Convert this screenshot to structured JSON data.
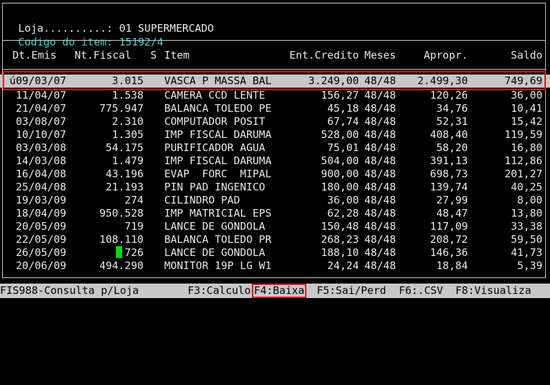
{
  "header": {
    "store_label": "Loja..........:",
    "store_value": "01 SUPERMERCADO",
    "item_label": "Codigo do item:",
    "item_value": "15192/4"
  },
  "columns": {
    "dt_emis": "Dt.Emis",
    "nt_fiscal": "Nt.Fiscal",
    "s": "S",
    "item": "Item",
    "ent_credito": "Ent.Credito",
    "meses": "Meses",
    "apropr": "Apropr.",
    "saldo": "Saldo"
  },
  "rows": [
    {
      "dt": "ú09/03/07",
      "nf": "3.015",
      "item": "VASCA P MASSA BAL",
      "ent": "3.249,00",
      "meses": "48/48",
      "apr": "2.499,30",
      "saldo": "749,69"
    },
    {
      "dt": "11/04/07",
      "nf": "1.538",
      "item": "CAMERA CCD LENTE",
      "ent": "156,27",
      "meses": "48/48",
      "apr": "120,26",
      "saldo": "36,00"
    },
    {
      "dt": "21/04/07",
      "nf": "775.947",
      "item": "BALANCA TOLEDO PE",
      "ent": "45,18",
      "meses": "48/48",
      "apr": "34,76",
      "saldo": "10,41"
    },
    {
      "dt": "03/08/07",
      "nf": "2.310",
      "item": "COMPUTADOR POSIT",
      "ent": "67,74",
      "meses": "48/48",
      "apr": "52,31",
      "saldo": "15,42"
    },
    {
      "dt": "10/10/07",
      "nf": "1.305",
      "item": "IMP FISCAL DARUMA",
      "ent": "528,00",
      "meses": "48/48",
      "apr": "408,40",
      "saldo": "119,59"
    },
    {
      "dt": "03/03/08",
      "nf": "54.175",
      "item": "PURIFICADOR AGUA",
      "ent": "75,01",
      "meses": "48/48",
      "apr": "58,20",
      "saldo": "16,80"
    },
    {
      "dt": "14/03/08",
      "nf": "1.479",
      "item": "IMP FISCAL DARUMA",
      "ent": "504,00",
      "meses": "48/48",
      "apr": "391,13",
      "saldo": "112,86"
    },
    {
      "dt": "16/04/08",
      "nf": "43.196",
      "item": "EVAP  FORC  MIPAL",
      "ent": "900,00",
      "meses": "48/48",
      "apr": "698,73",
      "saldo": "201,27"
    },
    {
      "dt": "25/04/08",
      "nf": "21.193",
      "item": "PIN PAD INGENICO",
      "ent": "180,00",
      "meses": "48/48",
      "apr": "139,74",
      "saldo": "40,25"
    },
    {
      "dt": "19/03/09",
      "nf": "274",
      "item": "CILINDRO PAD",
      "ent": "36,00",
      "meses": "48/48",
      "apr": "27,99",
      "saldo": "8,00"
    },
    {
      "dt": "18/04/09",
      "nf": "950.528",
      "item": "IMP MATRICIAL EPS",
      "ent": "62,28",
      "meses": "48/48",
      "apr": "48,47",
      "saldo": "13,80"
    },
    {
      "dt": "20/05/09",
      "nf": "719",
      "item": "LANCE DE GONDOLA",
      "ent": "150,48",
      "meses": "48/48",
      "apr": "117,09",
      "saldo": "33,38"
    },
    {
      "dt": "22/05/09",
      "nf": "108.110",
      "item": "BALANCA TOLEDO PR",
      "ent": "268,23",
      "meses": "48/48",
      "apr": "208,72",
      "saldo": "59,50"
    },
    {
      "dt": "26/05/09",
      "nf": "726",
      "item": "LANCE DE GONDOLA",
      "ent": "188,10",
      "meses": "48/48",
      "apr": "146,36",
      "saldo": "41,73"
    },
    {
      "dt": "20/06/09",
      "nf": "494.290",
      "item": "MONITOR 19P LG W1",
      "ent": "24,24",
      "meses": "48/48",
      "apr": "18,84",
      "saldo": "5,39"
    }
  ],
  "status": {
    "program": "FIS988-Consulta p/Loja",
    "f3": "F3:Calculo",
    "f4": "F4:Baixa",
    "f5": "F5:Sai/Perd",
    "f6": "F6:.CSV",
    "f8": "F8:Visualiza"
  },
  "colors": {
    "selected_row_bg": "#c8c8c8",
    "highlight_border": "#e01010",
    "cursor": "#00e000",
    "cyan_text": "#3fd6d6"
  }
}
